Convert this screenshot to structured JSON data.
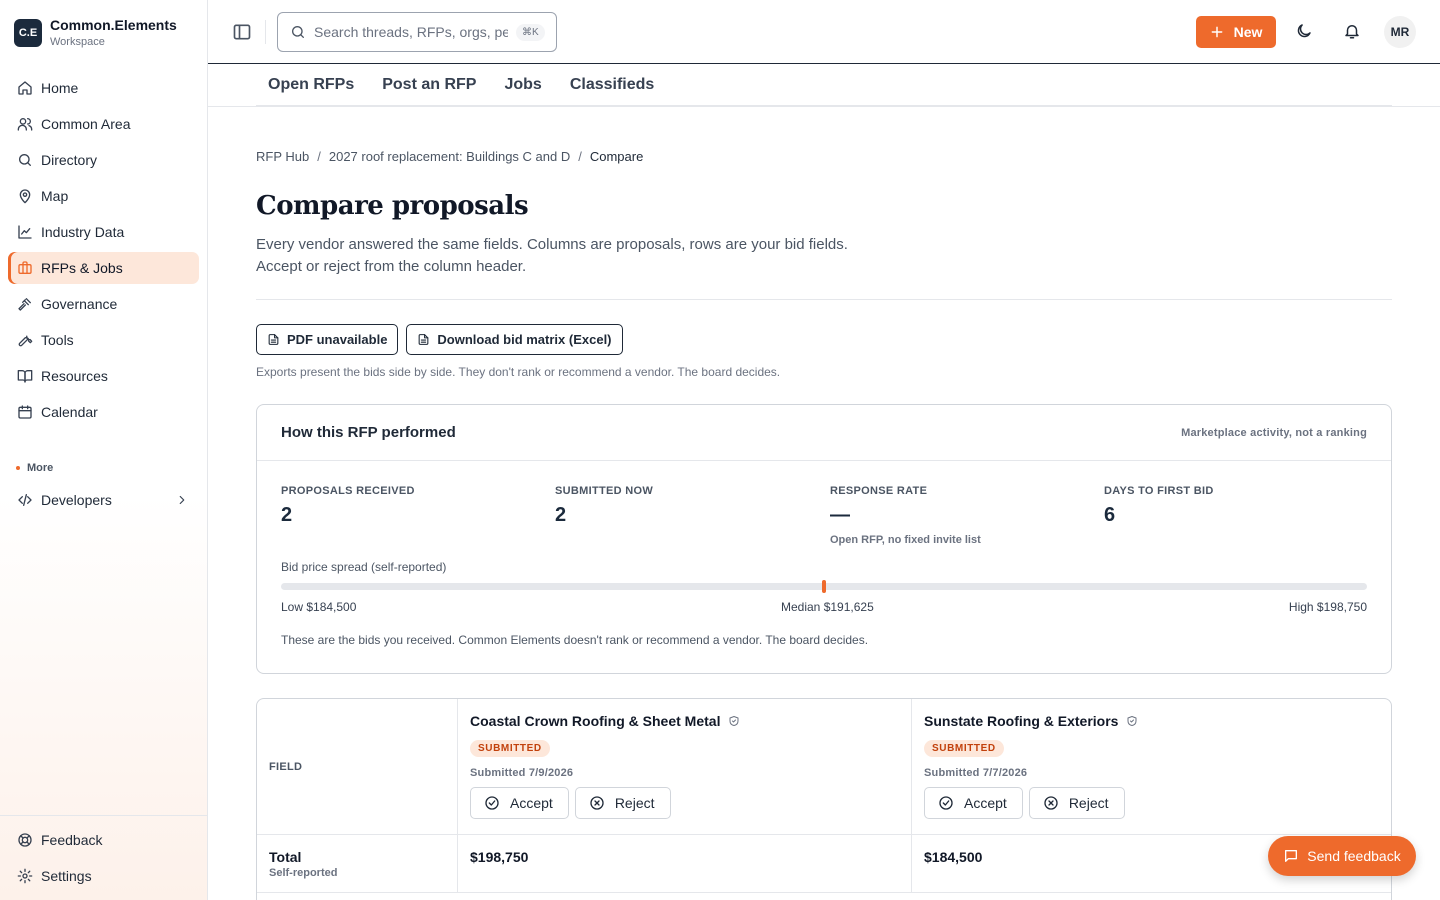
{
  "brand": {
    "logo_text": "C.E",
    "name": "Common.Elements",
    "sub": "Workspace"
  },
  "sidebar": {
    "items": [
      {
        "label": "Home",
        "icon": "home-icon"
      },
      {
        "label": "Common Area",
        "icon": "users-icon"
      },
      {
        "label": "Directory",
        "icon": "search-icon"
      },
      {
        "label": "Map",
        "icon": "map-pin-icon"
      },
      {
        "label": "Industry Data",
        "icon": "chart-line-icon"
      },
      {
        "label": "RFPs & Jobs",
        "icon": "briefcase-icon",
        "active": true
      },
      {
        "label": "Governance",
        "icon": "gavel-icon"
      },
      {
        "label": "Tools",
        "icon": "wrench-icon"
      },
      {
        "label": "Resources",
        "icon": "book-open-icon"
      },
      {
        "label": "Calendar",
        "icon": "calendar-icon"
      }
    ],
    "more_label": "More",
    "developers_label": "Developers",
    "bottom": [
      {
        "label": "Feedback",
        "icon": "lifebuoy-icon"
      },
      {
        "label": "Settings",
        "icon": "gear-icon"
      }
    ]
  },
  "topbar": {
    "search_placeholder": "Search threads, RFPs, orgs, people",
    "search_shortcut": "⌘K",
    "new_label": "New",
    "avatar_initials": "MR"
  },
  "subnav": {
    "tabs": [
      "Open RFPs",
      "Post an RFP",
      "Jobs",
      "Classifieds"
    ]
  },
  "breadcrumb": [
    "RFP Hub",
    "2027 roof replacement: Buildings C and D",
    "Compare"
  ],
  "page": {
    "title": "Compare proposals",
    "lede": "Every vendor answered the same fields. Columns are proposals, rows are your bid fields. Accept or reject from the column header."
  },
  "exports": {
    "pdf_label": "PDF unavailable",
    "excel_label": "Download bid matrix (Excel)",
    "note": "Exports present the bids side by side. They don't rank or recommend a vendor. The board decides."
  },
  "performance": {
    "title": "How this RFP performed",
    "tag": "Marketplace activity, not a ranking",
    "stats": [
      {
        "label": "PROPOSALS RECEIVED",
        "value": "2",
        "note": ""
      },
      {
        "label": "SUBMITTED NOW",
        "value": "2",
        "note": ""
      },
      {
        "label": "RESPONSE RATE",
        "value": "—",
        "note": "Open RFP, no fixed invite list"
      },
      {
        "label": "DAYS TO FIRST BID",
        "value": "6",
        "note": ""
      }
    ],
    "spread_label": "Bid price spread (self-reported)",
    "spread": {
      "low": 184500,
      "median": 191625,
      "high": 198750
    },
    "low_text": "Low $184,500",
    "median_text": "Median $191,625",
    "high_text": "High $198,750",
    "footer": "These are the bids you received. Common Elements doesn't rank or recommend a vendor. The board decides."
  },
  "compare": {
    "field_header": "FIELD",
    "vendors": [
      {
        "name": "Coastal Crown Roofing & Sheet Metal",
        "status": "SUBMITTED",
        "submitted": "Submitted 7/9/2026",
        "total": "$198,750"
      },
      {
        "name": "Sunstate Roofing & Exteriors",
        "status": "SUBMITTED",
        "submitted": "Submitted 7/7/2026",
        "total": "$184,500"
      }
    ],
    "accept_label": "Accept",
    "reject_label": "Reject",
    "rows": [
      {
        "label": "Total",
        "sub": "Self-reported"
      }
    ]
  },
  "feedback_button": "Send feedback",
  "colors": {
    "accent": "#ee6a2c",
    "navy": "#1b2a3c",
    "active_bg": "#fde7da"
  }
}
